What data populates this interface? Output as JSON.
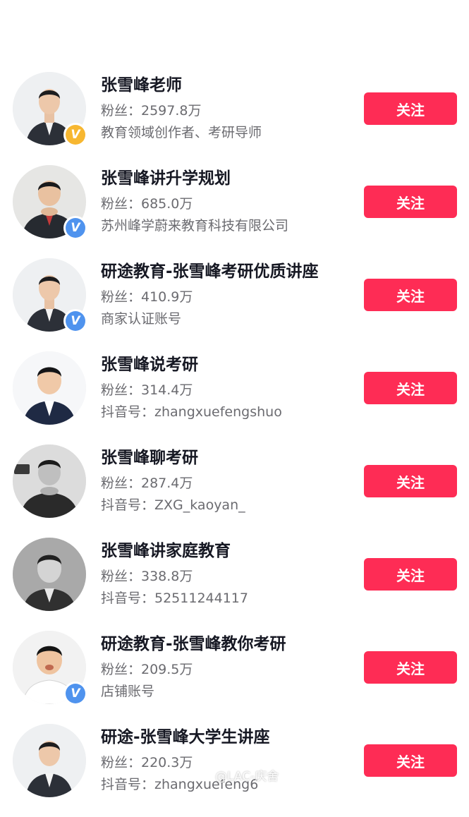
{
  "follow_label": "关注",
  "accent_color": "#fe2c55",
  "accounts": [
    {
      "name": "张雪峰老师",
      "fans": "粉丝：2597.8万",
      "desc": "教育领域创作者、考研导师",
      "badge": "yellow-v-badge-icon"
    },
    {
      "name": "张雪峰讲升学规划",
      "fans": "粉丝：685.0万",
      "desc": "苏州峰学蔚来教育科技有限公司",
      "badge": "blue-v-badge-icon"
    },
    {
      "name": "研途教育-张雪峰考研优质讲座",
      "fans": "粉丝：410.9万",
      "desc": "商家认证账号",
      "badge": "blue-v-badge-icon"
    },
    {
      "name": "张雪峰说考研",
      "fans": "粉丝：314.4万",
      "desc": "抖音号：zhangxuefengshuo",
      "badge": ""
    },
    {
      "name": "张雪峰聊考研",
      "fans": "粉丝：287.4万",
      "desc": "抖音号：ZXG_kaoyan_",
      "badge": ""
    },
    {
      "name": "张雪峰讲家庭教育",
      "fans": "粉丝：338.8万",
      "desc": "抖音号：52511244117",
      "badge": ""
    },
    {
      "name": "研途教育-张雪峰教你考研",
      "fans": "粉丝：209.5万",
      "desc": "店铺账号",
      "badge": "blue-v-badge-icon"
    },
    {
      "name": "研途-张雪峰大学生讲座",
      "fans": "粉丝：220.3万",
      "desc": "抖音号：zhangxuefeng6",
      "badge": ""
    }
  ],
  "watermark": "@LAC-庆舍"
}
